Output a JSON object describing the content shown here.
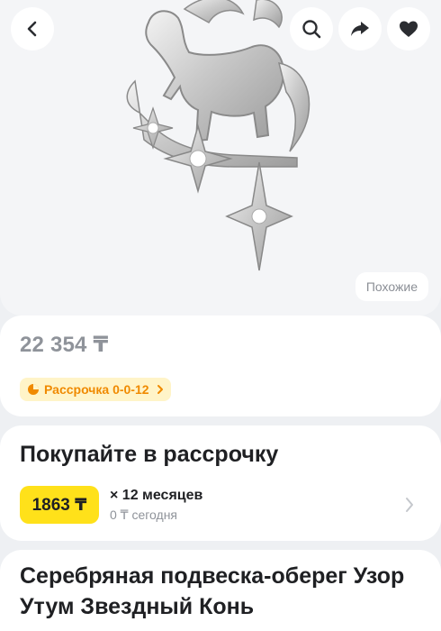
{
  "gallery": {
    "similar_label": "Похожие"
  },
  "toolbar": {
    "back_icon": "chevron-left-icon",
    "search_icon": "search-icon",
    "share_icon": "share-icon",
    "favorite_icon": "heart-icon"
  },
  "price": {
    "value": "22 354 ₸",
    "installment_chip": "Рассрочка 0-0-12"
  },
  "installment": {
    "title": "Покупайте в рассрочку",
    "monthly": "1863 ₸",
    "months": "× 12 месяцев",
    "today": "0 ₸ сегодня"
  },
  "product": {
    "title": "Серебряная подвеска-оберег Узор Утум Звездный Конь"
  },
  "colors": {
    "accent_yellow": "#ffe11a",
    "chip_bg": "#fff4c8",
    "chip_text": "#f08a00",
    "muted": "#8f939a"
  }
}
